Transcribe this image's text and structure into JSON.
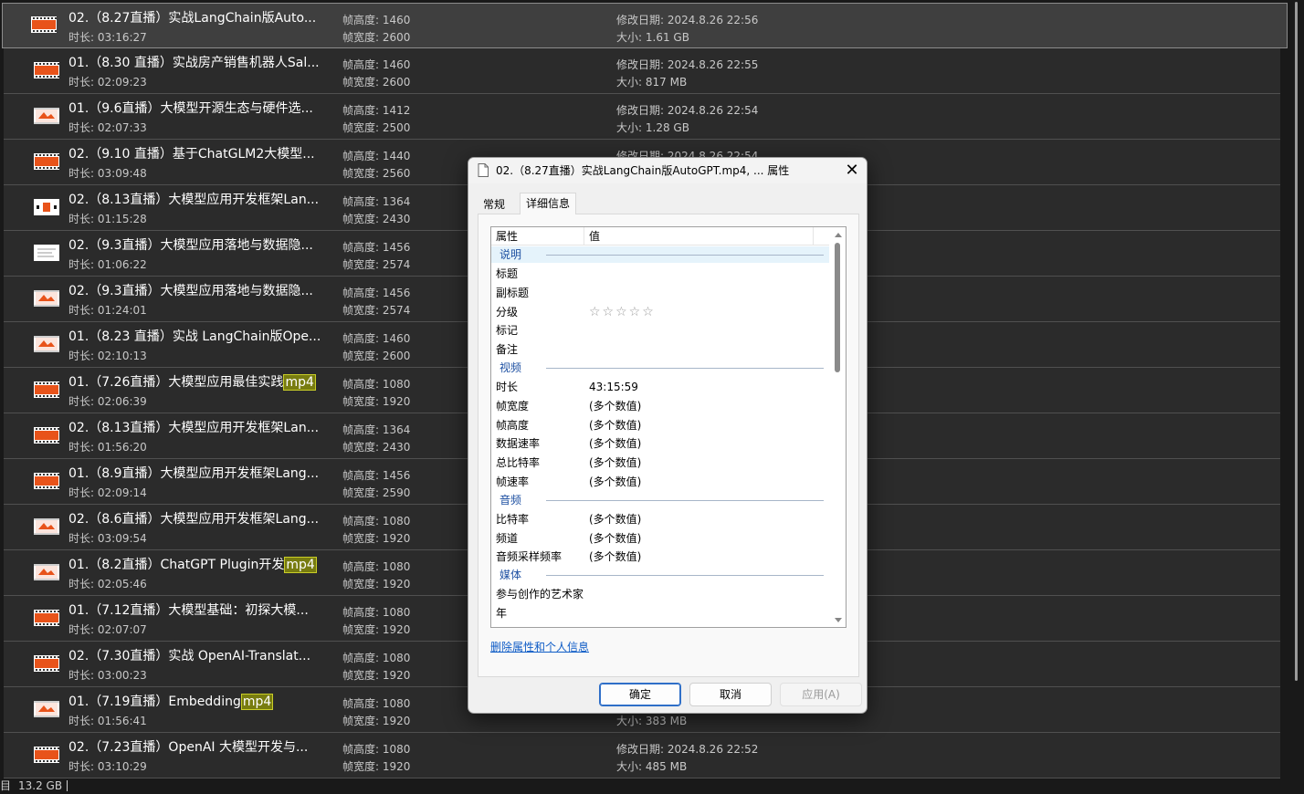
{
  "files": [
    {
      "name": "02.（8.27直播）实战LangChain版Auto...",
      "duration_label": "时长:",
      "duration": "03:16:27",
      "height_label": "帧高度:",
      "height": "1460",
      "width_label": "帧宽度:",
      "width": "2600",
      "date_label": "修改日期:",
      "date": "2024.8.26 22:56",
      "size_label": "大小:",
      "size": "1.61 GB",
      "icon": "video-file-icon",
      "selected": true
    },
    {
      "name": "01.（8.30 直播）实战房产销售机器人Sal...",
      "duration_label": "时长:",
      "duration": "02:09:23",
      "height_label": "帧高度:",
      "height": "1460",
      "width_label": "帧宽度:",
      "width": "2600",
      "date_label": "修改日期:",
      "date": "2024.8.26 22:55",
      "size_label": "大小:",
      "size": "817 MB",
      "icon": "video-file-icon"
    },
    {
      "name": "01.（9.6直播）大模型开源生态与硬件选...",
      "duration_label": "时长:",
      "duration": "02:07:33",
      "height_label": "帧高度:",
      "height": "1412",
      "width_label": "帧宽度:",
      "width": "2500",
      "date_label": "修改日期:",
      "date": "2024.8.26 22:54",
      "size_label": "大小:",
      "size": "1.28 GB",
      "icon": "video-file-icon"
    },
    {
      "name": "02.（9.10 直播）基于ChatGLM2大模型...",
      "duration_label": "时长:",
      "duration": "03:09:48",
      "height_label": "帧高度:",
      "height": "1440",
      "width_label": "帧宽度:",
      "width": "2560",
      "date_label": "修改日期:",
      "date": "2024.8.26 22:54",
      "size_label": "",
      "size": "",
      "icon": "video-file-icon"
    },
    {
      "name": "02.（8.13直播）大模型应用开发框架Lan...",
      "duration_label": "时长:",
      "duration": "01:15:28",
      "height_label": "帧高度:",
      "height": "1364",
      "width_label": "帧宽度:",
      "width": "2430",
      "date_label": "",
      "date": "",
      "size_label": "",
      "size": "",
      "icon": "video-file-icon"
    },
    {
      "name": "02.（9.3直播）大模型应用落地与数据隐...",
      "duration_label": "时长:",
      "duration": "01:06:22",
      "height_label": "帧高度:",
      "height": "1456",
      "width_label": "帧宽度:",
      "width": "2574",
      "date_label": "",
      "date": "",
      "size_label": "",
      "size": "",
      "icon": "video-file-icon"
    },
    {
      "name": "02.（9.3直播）大模型应用落地与数据隐...",
      "duration_label": "时长:",
      "duration": "01:24:01",
      "height_label": "帧高度:",
      "height": "1456",
      "width_label": "帧宽度:",
      "width": "2574",
      "date_label": "",
      "date": "",
      "size_label": "",
      "size": "",
      "icon": "video-file-icon"
    },
    {
      "name": "01.（8.23 直播）实战 LangChain版Ope...",
      "duration_label": "时长:",
      "duration": "02:10:13",
      "height_label": "帧高度:",
      "height": "1460",
      "width_label": "帧宽度:",
      "width": "2600",
      "date_label": "",
      "date": "",
      "size_label": "",
      "size": "",
      "icon": "video-file-icon"
    },
    {
      "name": "01.（7.26直播）大模型应用最佳实践",
      "ext": "mp4",
      "duration_label": "时长:",
      "duration": "02:06:39",
      "height_label": "帧高度:",
      "height": "1080",
      "width_label": "帧宽度:",
      "width": "1920",
      "date_label": "",
      "date": "",
      "size_label": "",
      "size": "",
      "icon": "video-file-icon"
    },
    {
      "name": "02.（8.13直播）大模型应用开发框架Lan...",
      "duration_label": "时长:",
      "duration": "01:56:20",
      "height_label": "帧高度:",
      "height": "1364",
      "width_label": "帧宽度:",
      "width": "2430",
      "date_label": "",
      "date": "",
      "size_label": "",
      "size": "",
      "icon": "video-file-icon"
    },
    {
      "name": "01.（8.9直播）大模型应用开发框架Lang...",
      "duration_label": "时长:",
      "duration": "02:09:14",
      "height_label": "帧高度:",
      "height": "1456",
      "width_label": "帧宽度:",
      "width": "2590",
      "date_label": "",
      "date": "",
      "size_label": "",
      "size": "",
      "icon": "video-file-icon"
    },
    {
      "name": "02.（8.6直播）大模型应用开发框架Lang...",
      "duration_label": "时长:",
      "duration": "03:09:54",
      "height_label": "帧高度:",
      "height": "1080",
      "width_label": "帧宽度:",
      "width": "1920",
      "date_label": "",
      "date": "",
      "size_label": "",
      "size": "",
      "icon": "video-file-icon"
    },
    {
      "name": "01.（8.2直播）ChatGPT Plugin开发",
      "ext": "mp4",
      "duration_label": "时长:",
      "duration": "02:05:46",
      "height_label": "帧高度:",
      "height": "1080",
      "width_label": "帧宽度:",
      "width": "1920",
      "date_label": "",
      "date": "",
      "size_label": "",
      "size": "",
      "icon": "video-file-icon"
    },
    {
      "name": "01.（7.12直播）大模型基础：初探大模...",
      "duration_label": "时长:",
      "duration": "02:07:07",
      "height_label": "帧高度:",
      "height": "1080",
      "width_label": "帧宽度:",
      "width": "1920",
      "date_label": "",
      "date": "",
      "size_label": "",
      "size": "",
      "icon": "video-file-icon"
    },
    {
      "name": "02.（7.30直播）实战 OpenAI-Translat...",
      "duration_label": "时长:",
      "duration": "03:00:23",
      "height_label": "帧高度:",
      "height": "1080",
      "width_label": "帧宽度:",
      "width": "1920",
      "date_label": "",
      "date": "",
      "size_label": "",
      "size": "",
      "icon": "video-file-icon"
    },
    {
      "name": "01.（7.19直播）Embedding",
      "ext": "mp4",
      "duration_label": "时长:",
      "duration": "01:56:41",
      "height_label": "帧高度:",
      "height": "1080",
      "width_label": "帧宽度:",
      "width": "1920",
      "date_label": "",
      "date": "",
      "size_label": "大小:",
      "size": "383 MB",
      "icon": "video-file-icon"
    },
    {
      "name": "02.（7.23直播）OpenAI 大模型开发与...",
      "duration_label": "时长:",
      "duration": "03:10:29",
      "height_label": "帧高度:",
      "height": "1080",
      "width_label": "帧宽度:",
      "width": "1920",
      "date_label": "修改日期:",
      "date": "2024.8.26 22:52",
      "size_label": "大小:",
      "size": "485 MB",
      "icon": "video-file-icon"
    }
  ],
  "status_bar": {
    "item_count_fragment": "目",
    "selected_size": "13.2 GB"
  },
  "dialog": {
    "title": "02.（8.27直播）实战LangChain版AutoGPT.mp4, ... 属性",
    "close_glyph": "✕",
    "tabs": {
      "general": "常规",
      "details": "详细信息"
    },
    "table": {
      "col_property": "属性",
      "col_value": "值",
      "groups": {
        "description": "说明",
        "video": "视频",
        "audio": "音频",
        "media": "媒体"
      },
      "description_rows": [
        {
          "name": "标题",
          "value": ""
        },
        {
          "name": "副标题",
          "value": ""
        },
        {
          "name": "分级",
          "value": "☆☆☆☆☆"
        },
        {
          "name": "标记",
          "value": ""
        },
        {
          "name": "备注",
          "value": ""
        }
      ],
      "video_rows": [
        {
          "name": "时长",
          "value": "43:15:59"
        },
        {
          "name": "帧宽度",
          "value": "(多个数值)"
        },
        {
          "name": "帧高度",
          "value": "(多个数值)"
        },
        {
          "name": "数据速率",
          "value": "(多个数值)"
        },
        {
          "name": "总比特率",
          "value": "(多个数值)"
        },
        {
          "name": "帧速率",
          "value": "(多个数值)"
        }
      ],
      "audio_rows": [
        {
          "name": "比特率",
          "value": "(多个数值)"
        },
        {
          "name": "频道",
          "value": "(多个数值)"
        },
        {
          "name": "音频采样频率",
          "value": "(多个数值)"
        }
      ],
      "media_rows": [
        {
          "name": "参与创作的艺术家",
          "value": ""
        },
        {
          "name": "年",
          "value": ""
        }
      ]
    },
    "remove_link": "删除属性和个人信息",
    "buttons": {
      "ok": "确定",
      "cancel": "取消",
      "apply": "应用(A)"
    }
  },
  "colors": {
    "explorer_background": "#2b2b2b",
    "selected_row": "#3f3f3f",
    "search_highlight": "#787c10",
    "icon_orange": "#e8531a",
    "link_blue": "#0d5bc6",
    "group_label_blue": "#1e50a2"
  }
}
